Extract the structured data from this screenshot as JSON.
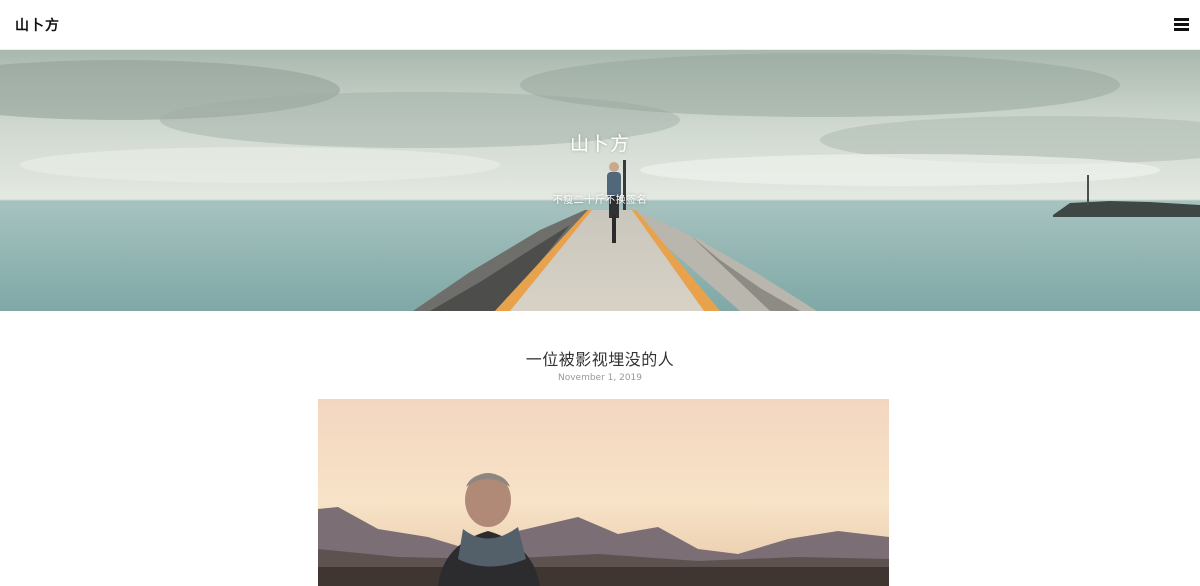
{
  "header": {
    "brand": "山卜方",
    "menu_icon": "hamburger-menu-icon"
  },
  "hero": {
    "title": "山卜方",
    "subtitle": "不瘦二十斤不换签名",
    "image": "pier-cyclist-sea-photo"
  },
  "post": {
    "title": "一位被影视埋没的人",
    "date": "November 1, 2019",
    "image": "man-scarf-desert-mountains-photo"
  }
}
